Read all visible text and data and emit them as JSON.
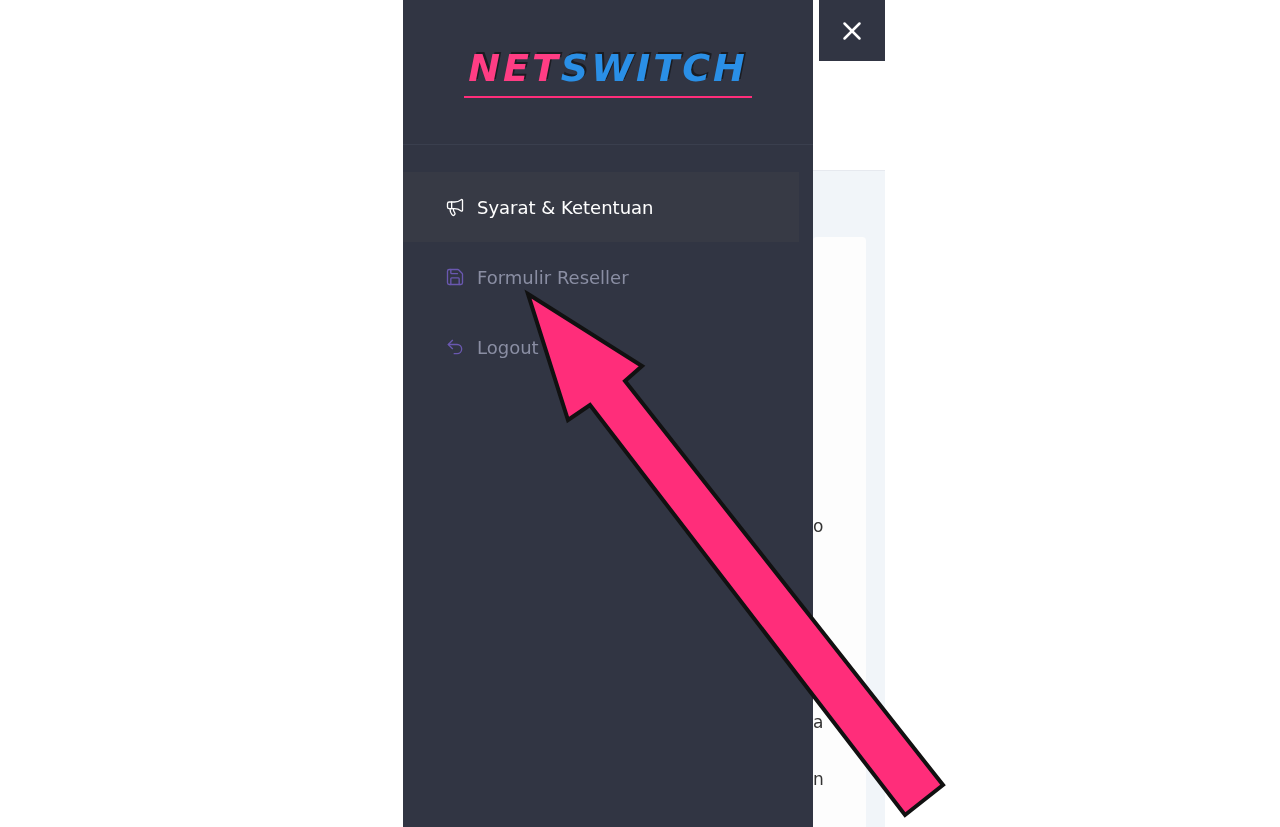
{
  "logo": {
    "parts": [
      "NET",
      "SWITCH"
    ]
  },
  "menu": [
    {
      "label": "Syarat & Ketentuan",
      "kind": "megaphone",
      "selected": true
    },
    {
      "label": "Formulir Reseller",
      "kind": "save",
      "selected": false
    },
    {
      "label": "Logout",
      "kind": "logout",
      "selected": false
    }
  ],
  "content_fragments": [
    "o",
    "a",
    "n"
  ]
}
